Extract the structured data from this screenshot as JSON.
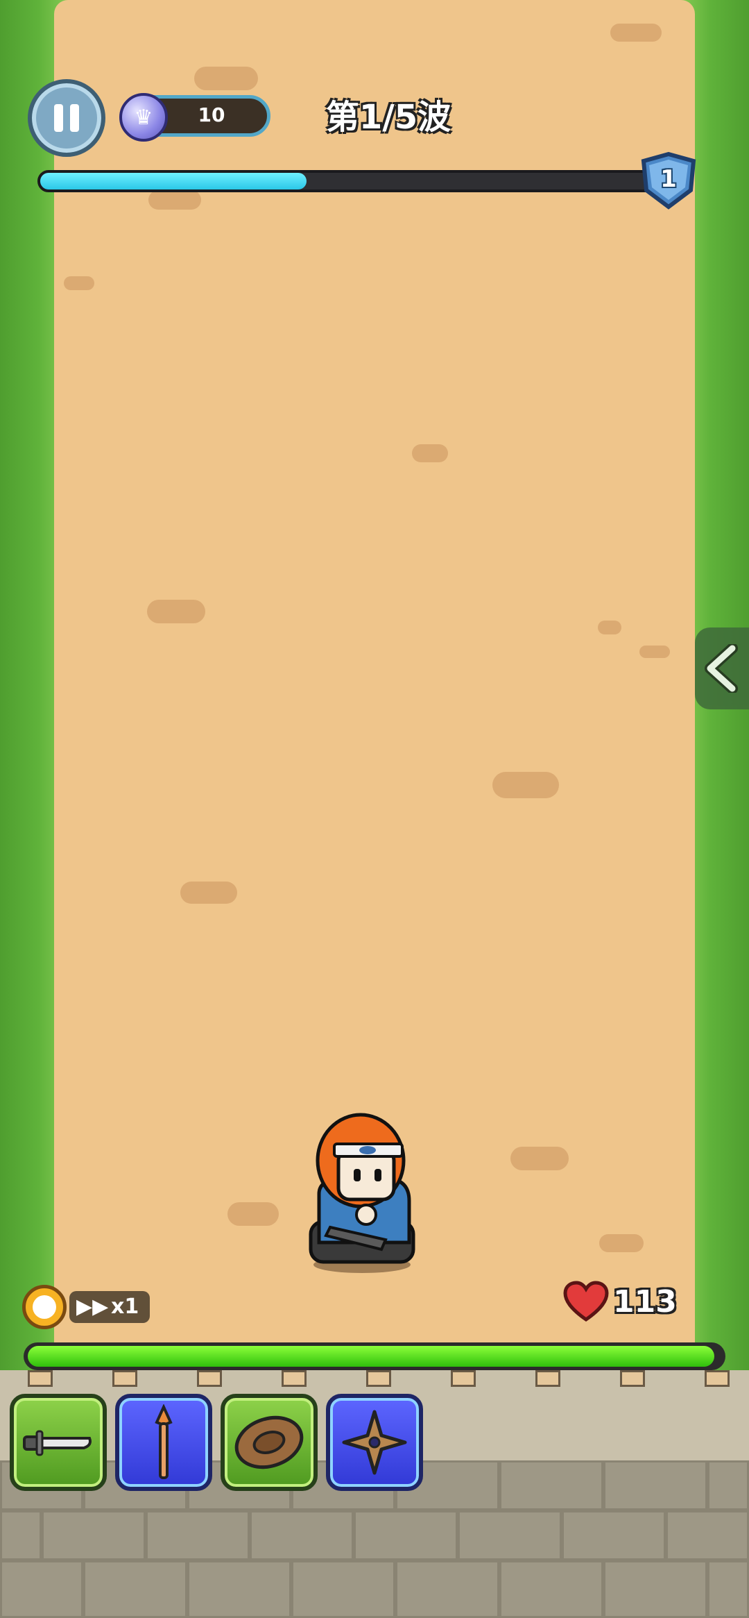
{
  "hud": {
    "gems": "10",
    "wave_label": "第1/5波",
    "wave_progress": 0.43,
    "level": "1"
  },
  "battle": {
    "speed_multiplier": "x1",
    "hp": "113",
    "wall_hp_fraction": 0.99
  },
  "skills": [
    {
      "icon": "sword-icon",
      "theme": "green"
    },
    {
      "icon": "spear-icon",
      "theme": "blue"
    },
    {
      "icon": "shield-icon",
      "theme": "green"
    },
    {
      "icon": "shuriken-icon",
      "theme": "blue"
    }
  ],
  "colors": {
    "path": "#efc58b",
    "grass": "#5fb23a",
    "progress": "#2bc7e8",
    "hp_bar": "#2fbf0c",
    "heart": "#e23b3b"
  }
}
